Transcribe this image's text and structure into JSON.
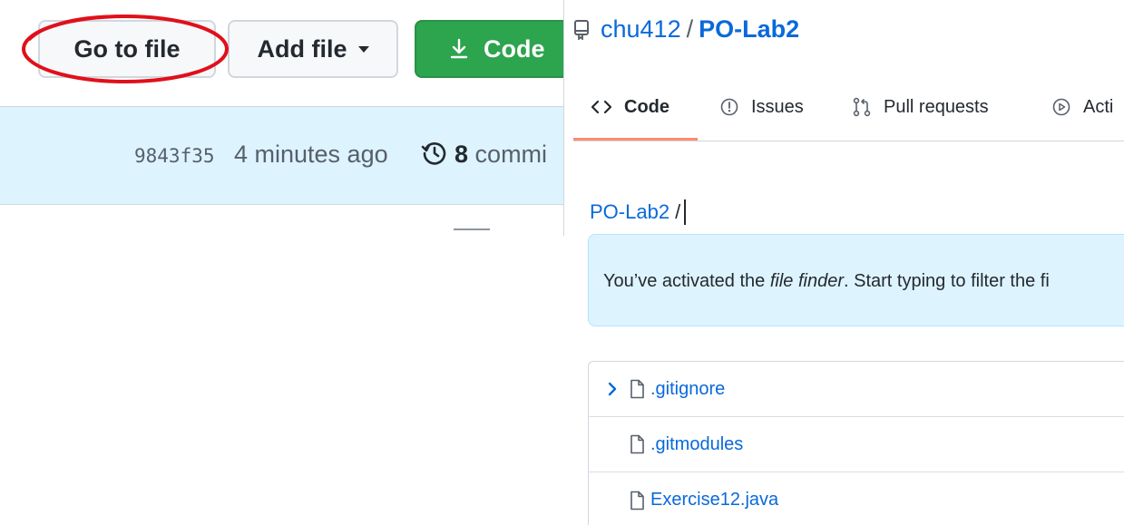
{
  "left": {
    "buttons": {
      "go_to_file": "Go to file",
      "add_file": "Add file",
      "code": "Code"
    },
    "commit": {
      "sha": "9843f35",
      "time": "4 minutes ago",
      "count": "8",
      "label": "commi"
    },
    "annotation_color": "#e0101a"
  },
  "right": {
    "repo": {
      "owner": "chu412",
      "separator": "/",
      "name": "PO-Lab2"
    },
    "tabs": [
      {
        "label": "Code",
        "icon": "code-icon",
        "selected": true
      },
      {
        "label": "Issues",
        "icon": "issue-opened-icon"
      },
      {
        "label": "Pull requests",
        "icon": "git-pull-request-icon"
      },
      {
        "label": "Acti",
        "icon": "play-icon"
      }
    ],
    "finder": {
      "repo": "PO-Lab2",
      "slash": "/",
      "input_value": ""
    },
    "flash": {
      "prefix": "You’ve activated the ",
      "emphasis": "file finder",
      "suffix": ". Start typing to filter the fi"
    },
    "files": [
      {
        "name": ".gitignore",
        "selected": true
      },
      {
        "name": ".gitmodules"
      },
      {
        "name": "Exercise12.java"
      }
    ]
  },
  "colors": {
    "link": "#0969da",
    "green": "#2da44e",
    "highlight_bg": "#ddf4ff",
    "tab_underline": "#fd8c73"
  }
}
